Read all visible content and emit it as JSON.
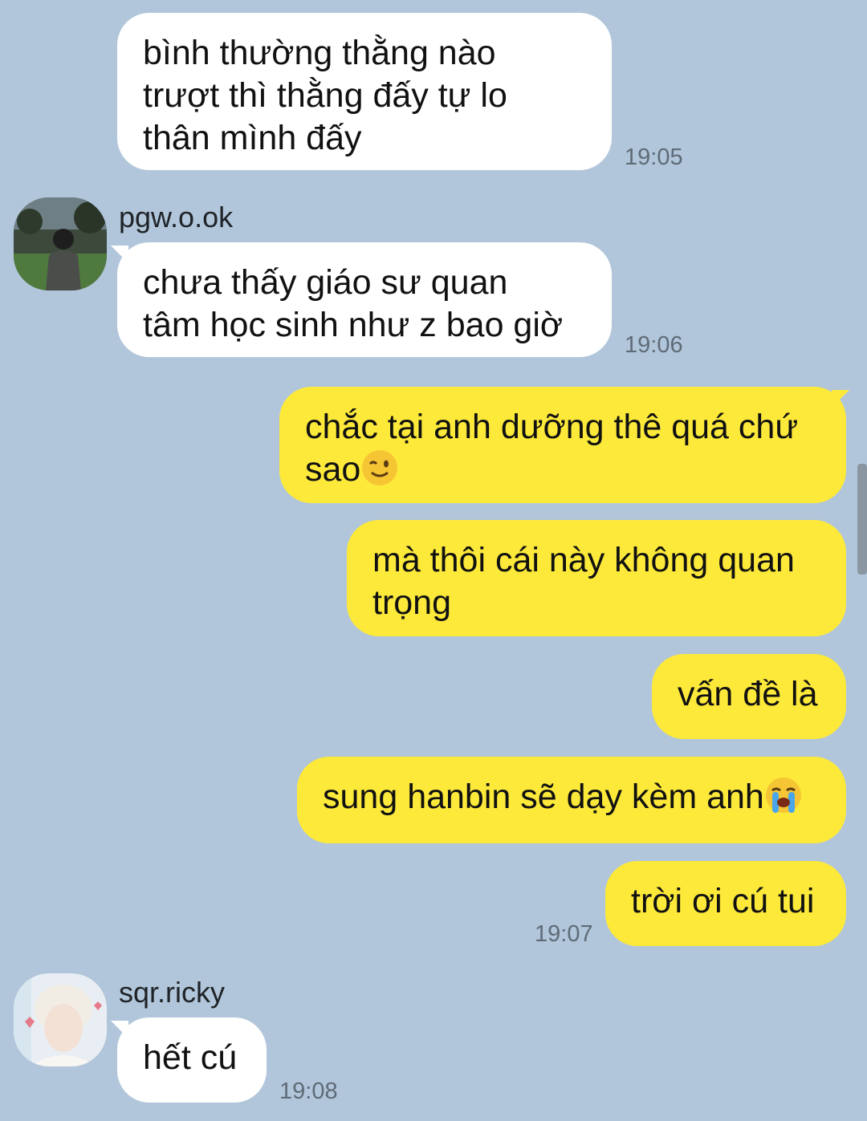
{
  "messages": [
    {
      "lines": [
        "bình thường thằng nào",
        "trượt thì thằng đấy tự lo",
        "thân mình đấy"
      ],
      "time": "19:05"
    },
    {
      "sender": "pgw.o.ok",
      "lines": [
        "chưa thấy giáo sư quan",
        "tâm học sinh như z bao giờ"
      ],
      "time": "19:06"
    },
    {
      "lines": [
        "chắc tại anh dưỡng thê quá chứ",
        "sao"
      ],
      "emoji": "winking-face-emoji"
    },
    {
      "lines": [
        "mà thôi cái này không quan",
        "trọng"
      ]
    },
    {
      "lines": [
        "vấn đề là"
      ]
    },
    {
      "lines": [
        "sung hanbin sẽ dạy kèm anh"
      ],
      "emoji": "loudly-crying-face-emoji"
    },
    {
      "lines": [
        "trời ơi cú tui"
      ],
      "time": "19:07"
    },
    {
      "sender": "sqr.ricky",
      "lines": [
        "hết cú"
      ],
      "time": "19:08"
    }
  ],
  "colors": {
    "background": "#b1c6da",
    "incoming_bubble": "#ffffff",
    "outgoing_bubble": "#fde93a"
  }
}
